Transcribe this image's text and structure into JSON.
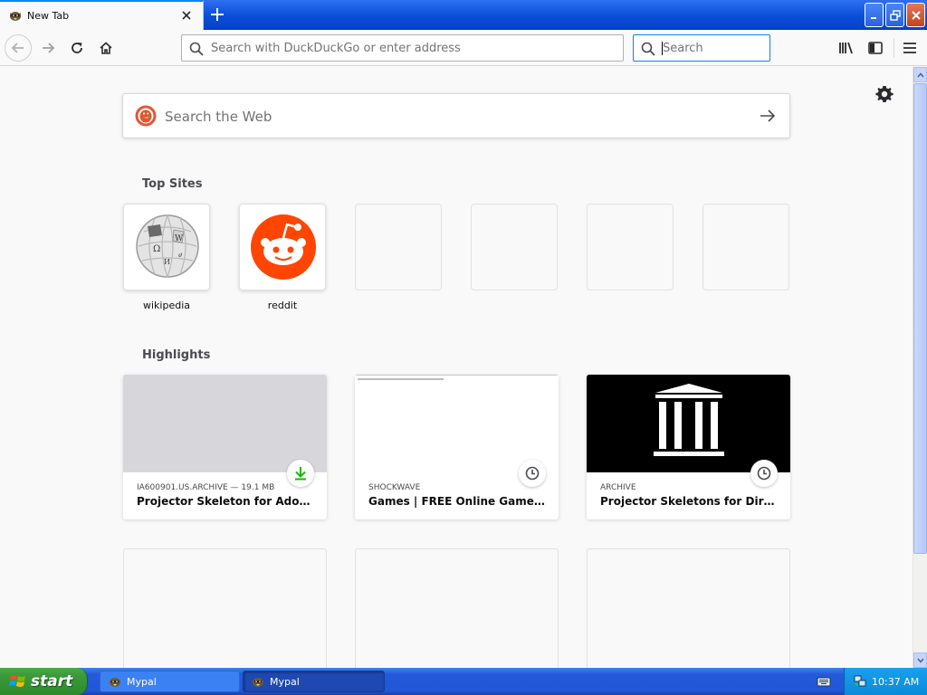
{
  "browser": {
    "tab": {
      "title": "New Tab",
      "favicon_icon": "mypal-raccoon-icon"
    },
    "new_tab_icon": "plus-icon",
    "window_buttons": [
      "minimize-icon",
      "restore-icon",
      "close-icon"
    ],
    "urlbar": {
      "placeholder": "Search with DuckDuckGo or enter address"
    },
    "searchbar": {
      "placeholder": "Search"
    },
    "nav_icons": [
      "back-arrow-icon",
      "forward-arrow-icon",
      "reload-icon",
      "home-icon",
      "library-icon",
      "sidebar-icon",
      "hamburger-menu-icon"
    ]
  },
  "newtab": {
    "web_search": {
      "placeholder": "Search the Web",
      "engine_icon": "duckduckgo-icon"
    },
    "settings_icon": "gear-icon",
    "topsites": {
      "title": "Top Sites",
      "sites": [
        {
          "label": "wikipedia",
          "icon": "wikipedia-globe-icon"
        },
        {
          "label": "reddit",
          "icon": "reddit-alien-icon"
        }
      ],
      "empty_slots": 4
    },
    "highlights": {
      "title": "Highlights",
      "cards": [
        {
          "source": "IA600901.US.ARCHIVE — 19.1 MB",
          "title": "Projector Skeleton for Adobe Di…",
          "badge": "download-icon",
          "thumb_color": "#d7d7db"
        },
        {
          "source": "SHOCKWAVE",
          "title": "Games | FREE Online Games & D…",
          "badge": "clock-icon",
          "thumb_color": "#ffffff"
        },
        {
          "source": "ARCHIVE",
          "title": "Projector Skeletons for Director…",
          "badge": "clock-icon",
          "thumb_color": "#000000"
        }
      ]
    }
  },
  "taskbar": {
    "start_label": "start",
    "tasks": [
      {
        "label": "Mypal",
        "active": false
      },
      {
        "label": "Mypal",
        "active": true
      }
    ],
    "clock": "10:37 AM"
  },
  "colors": {
    "accent": "#0a84ff",
    "download_green": "#12bc00",
    "reddit_orange": "#ff4500",
    "xp_blue": "#2459d8",
    "start_green": "#3a9a3a"
  }
}
